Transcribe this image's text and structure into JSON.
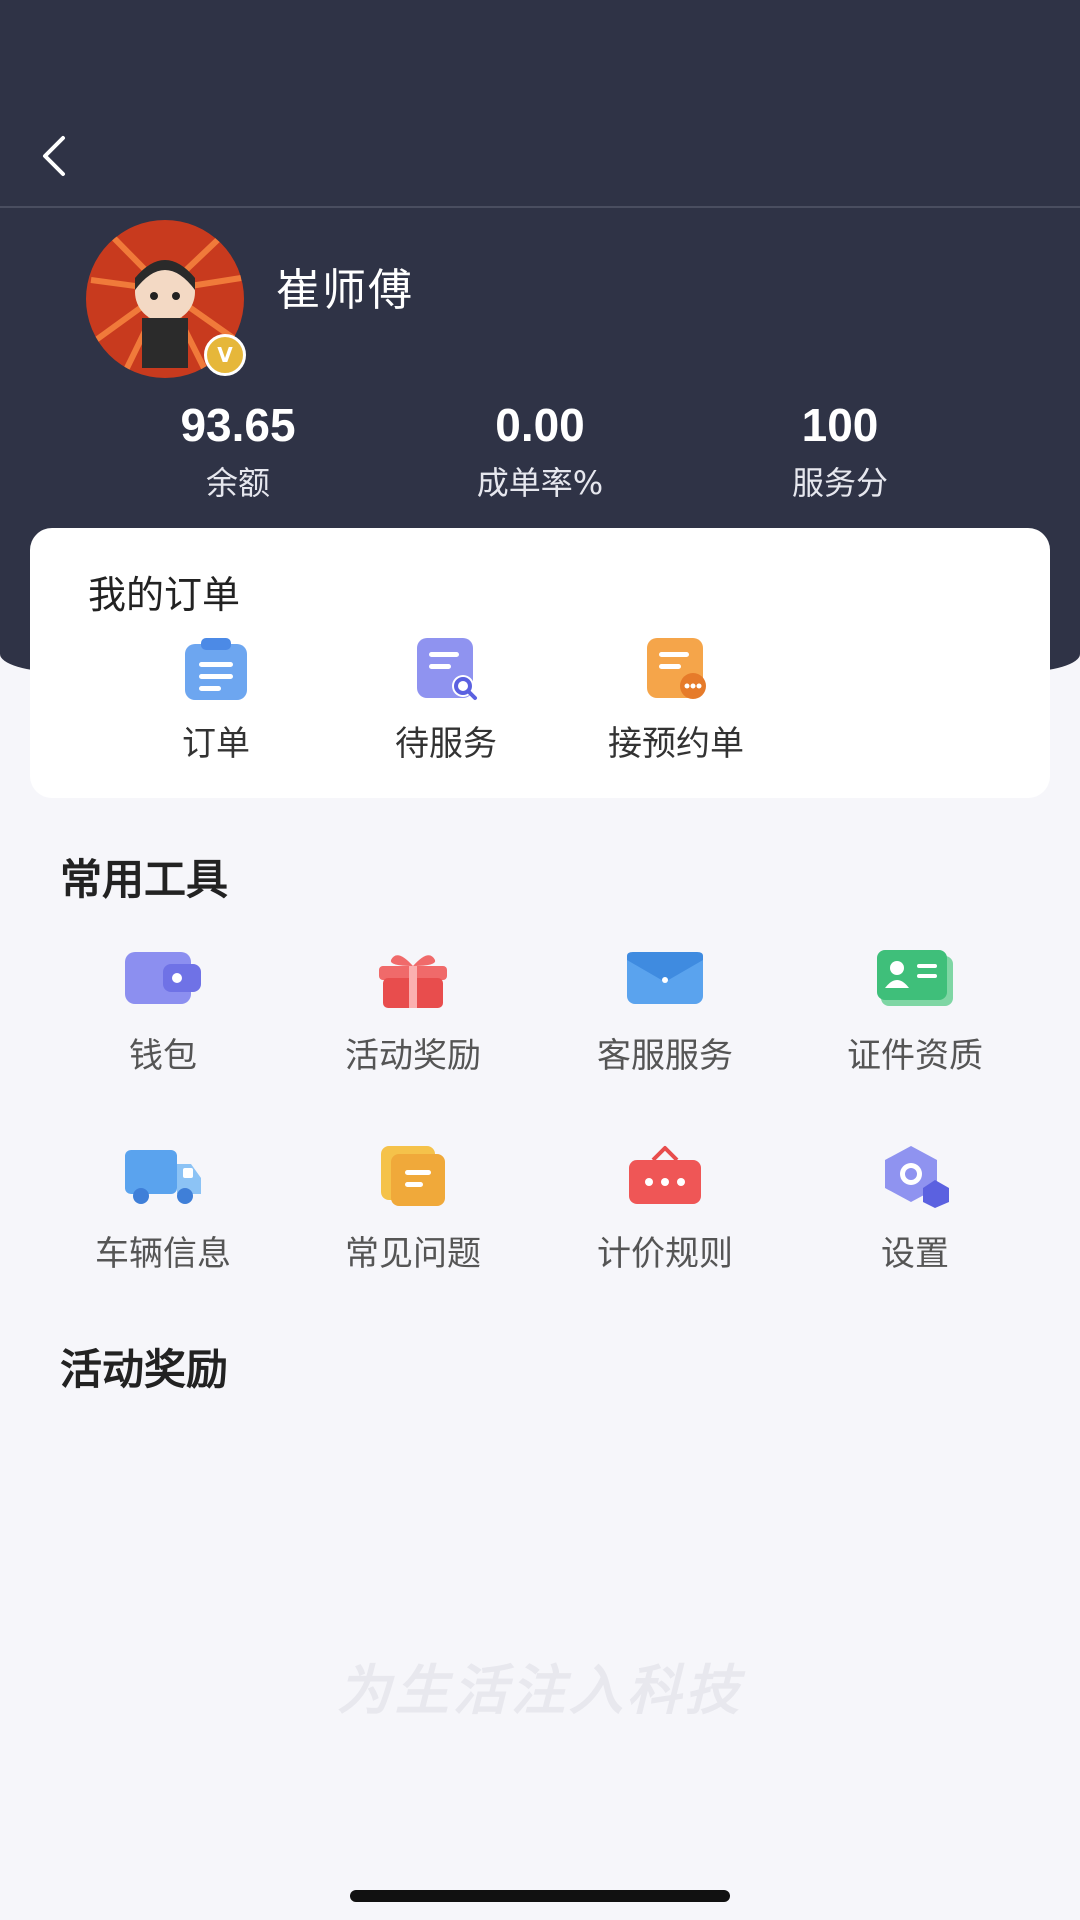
{
  "user": {
    "name": "崔师傅",
    "verified_mark": "V"
  },
  "stats": [
    {
      "value": "93.65",
      "label": "余额"
    },
    {
      "value": "0.00",
      "label": "成单率%"
    },
    {
      "value": "100",
      "label": "服务分"
    }
  ],
  "orders": {
    "title": "我的订单",
    "items": [
      {
        "label": "订单",
        "icon": "order-icon"
      },
      {
        "label": "待服务",
        "icon": "pending-service-icon"
      },
      {
        "label": "接预约单",
        "icon": "reservation-icon"
      }
    ]
  },
  "tools": {
    "title": "常用工具",
    "items": [
      {
        "label": "钱包",
        "icon": "wallet-icon"
      },
      {
        "label": "活动奖励",
        "icon": "gift-icon"
      },
      {
        "label": "客服服务",
        "icon": "mail-icon"
      },
      {
        "label": "证件资质",
        "icon": "id-card-icon"
      },
      {
        "label": "车辆信息",
        "icon": "truck-icon"
      },
      {
        "label": "常见问题",
        "icon": "faq-icon"
      },
      {
        "label": "计价规则",
        "icon": "pricing-icon"
      },
      {
        "label": "设置",
        "icon": "settings-icon"
      }
    ]
  },
  "activity": {
    "title": "活动奖励"
  },
  "watermark": "为生活注入科技",
  "colors": {
    "header_bg": "#2f3346",
    "page_bg": "#f6f6fa",
    "card_bg": "#ffffff",
    "badge": "#e6b73a"
  }
}
